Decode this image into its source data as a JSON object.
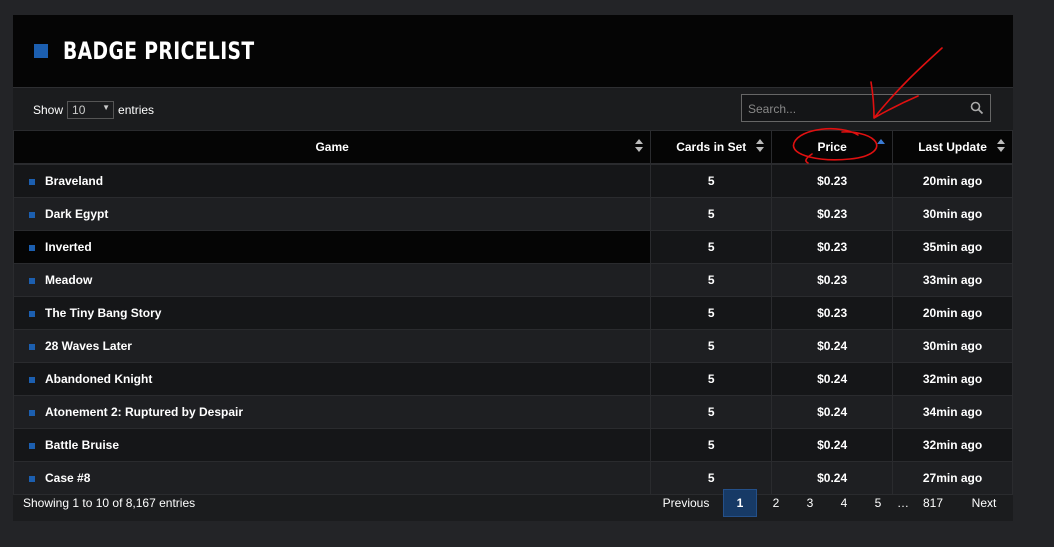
{
  "header": {
    "title": "BADGE PRICELIST"
  },
  "controls": {
    "show_label": "Show",
    "entries_value": "10",
    "entries_label": "entries",
    "search_placeholder": "Search..."
  },
  "table": {
    "columns": [
      "Game",
      "Cards in Set",
      "Price",
      "Last Update"
    ],
    "rows": [
      {
        "game": "Braveland",
        "cards": "5",
        "price": "$0.23",
        "updated": "20min ago"
      },
      {
        "game": "Dark Egypt",
        "cards": "5",
        "price": "$0.23",
        "updated": "30min ago"
      },
      {
        "game": "Inverted",
        "cards": "5",
        "price": "$0.23",
        "updated": "35min ago"
      },
      {
        "game": "Meadow",
        "cards": "5",
        "price": "$0.23",
        "updated": "33min ago"
      },
      {
        "game": "The Tiny Bang Story",
        "cards": "5",
        "price": "$0.23",
        "updated": "20min ago"
      },
      {
        "game": "28 Waves Later",
        "cards": "5",
        "price": "$0.24",
        "updated": "30min ago"
      },
      {
        "game": "Abandoned Knight",
        "cards": "5",
        "price": "$0.24",
        "updated": "32min ago"
      },
      {
        "game": "Atonement 2: Ruptured by Despair",
        "cards": "5",
        "price": "$0.24",
        "updated": "34min ago"
      },
      {
        "game": "Battle Bruise",
        "cards": "5",
        "price": "$0.24",
        "updated": "32min ago"
      },
      {
        "game": "Case #8",
        "cards": "5",
        "price": "$0.24",
        "updated": "27min ago"
      }
    ]
  },
  "footer": {
    "info": "Showing 1 to 10 of 8,167 entries",
    "previous": "Previous",
    "pages": [
      "1",
      "2",
      "3",
      "4",
      "5"
    ],
    "ellipsis": "…",
    "last_page": "817",
    "next": "Next"
  },
  "colors": {
    "accent": "#1c5fb0",
    "annotation": "#e01010"
  }
}
